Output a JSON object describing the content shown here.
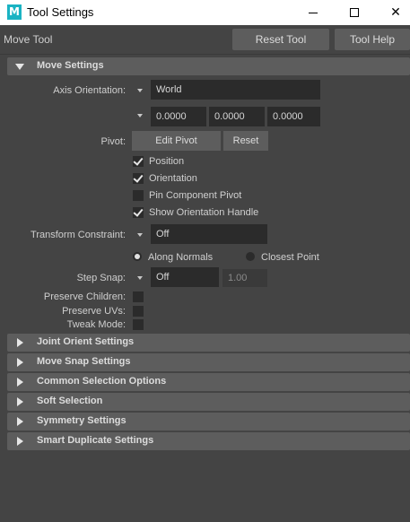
{
  "window": {
    "app_icon": "M",
    "title": "Tool Settings"
  },
  "header": {
    "tool_name": "Move Tool",
    "reset_label": "Reset Tool",
    "help_label": "Tool Help"
  },
  "move_settings": {
    "title": "Move Settings",
    "axis_orientation_label": "Axis Orientation:",
    "axis_orientation_value": "World",
    "axis_values": [
      "0.0000",
      "0.0000",
      "0.0000"
    ],
    "pivot_label": "Pivot:",
    "edit_pivot_label": "Edit Pivot",
    "reset_label": "Reset",
    "checkboxes": [
      {
        "label": "Position",
        "checked": true
      },
      {
        "label": "Orientation",
        "checked": true
      },
      {
        "label": "Pin Component Pivot",
        "checked": false
      },
      {
        "label": "Show Orientation Handle",
        "checked": true
      }
    ],
    "transform_constraint_label": "Transform Constraint:",
    "transform_constraint_value": "Off",
    "radio_along_normals": "Along Normals",
    "radio_closest_point": "Closest Point",
    "step_snap_label": "Step Snap:",
    "step_snap_value": "Off",
    "step_snap_amount": "1.00",
    "preserve_children_label": "Preserve Children:",
    "preserve_uvs_label": "Preserve UVs:",
    "tweak_mode_label": "Tweak Mode:"
  },
  "sections": [
    "Joint Orient Settings",
    "Move Snap Settings",
    "Common Selection Options",
    "Soft Selection",
    "Symmetry Settings",
    "Smart Duplicate Settings"
  ],
  "colors": {
    "background": "#444444",
    "section_header": "#5d5d5d",
    "field": "#2b2b2b",
    "app_icon": "#1ab3c3"
  }
}
